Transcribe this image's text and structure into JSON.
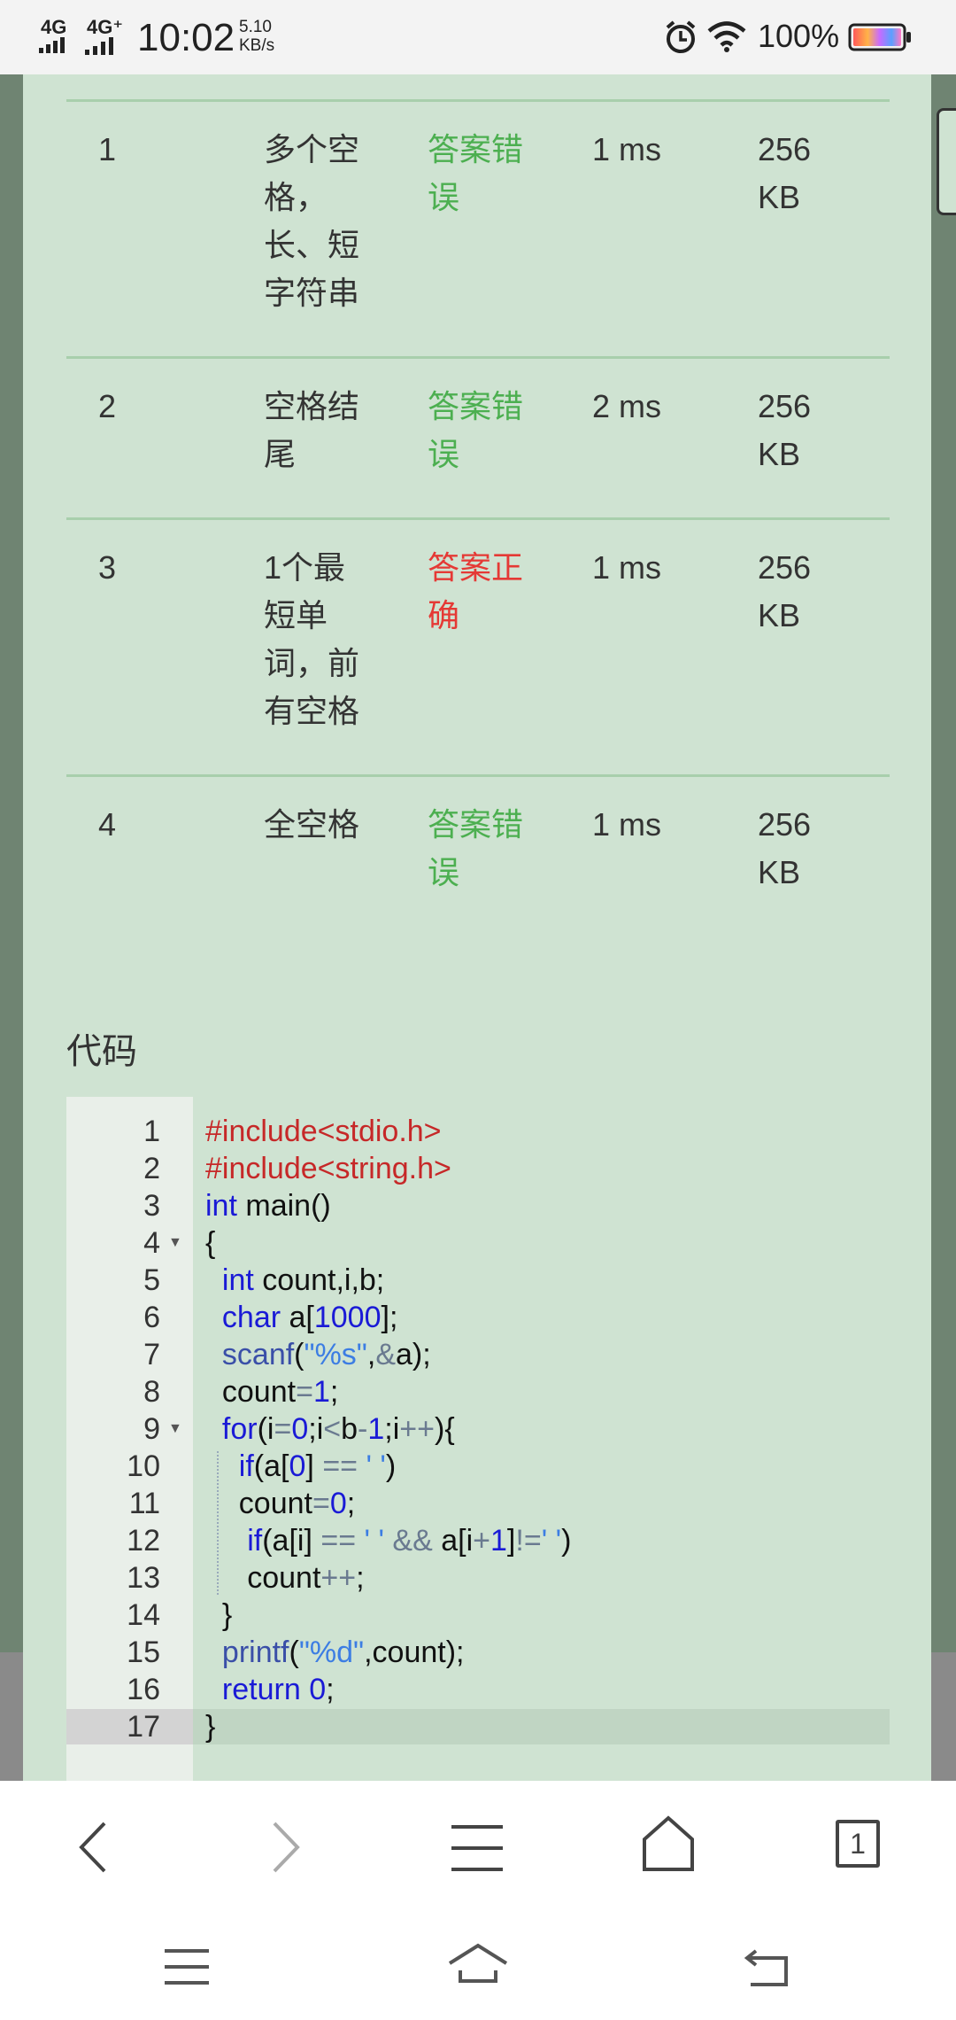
{
  "status_bar": {
    "signal_1": "4G",
    "signal_2": "4G⁺",
    "time": "10:02",
    "speed_value": "5.10",
    "speed_unit": "KB/s",
    "battery_pct": "100%"
  },
  "results": {
    "rows": [
      {
        "num": "1",
        "name_lines": [
          "多个空",
          "格，",
          "长、短",
          "字符串"
        ],
        "result_lines": [
          "答案错",
          "误"
        ],
        "result_type": "wrong",
        "time": "1 ms",
        "mem_lines": [
          "256",
          "KB"
        ]
      },
      {
        "num": "2",
        "name_lines": [
          "空格结",
          "尾"
        ],
        "result_lines": [
          "答案错",
          "误"
        ],
        "result_type": "wrong",
        "time": "2 ms",
        "mem_lines": [
          "256",
          "KB"
        ]
      },
      {
        "num": "3",
        "name_lines": [
          "1个最",
          "短单",
          "词，前",
          "有空格"
        ],
        "result_lines": [
          "答案正",
          "确"
        ],
        "result_type": "right",
        "time": "1 ms",
        "mem_lines": [
          "256",
          "KB"
        ]
      },
      {
        "num": "4",
        "name_lines": [
          "全空格"
        ],
        "result_lines": [
          "答案错",
          "误"
        ],
        "result_type": "wrong",
        "time": "1 ms",
        "mem_lines": [
          "256",
          "KB"
        ]
      }
    ]
  },
  "code": {
    "title": "代码",
    "active_line": 17,
    "fold_lines": [
      4,
      9
    ],
    "lines": [
      [
        [
          "inc",
          "#include"
        ],
        [
          "inc",
          "<stdio.h>"
        ]
      ],
      [
        [
          "inc",
          "#include"
        ],
        [
          "inc",
          "<string.h>"
        ]
      ],
      [
        [
          "kw",
          "int"
        ],
        [
          "",
          " main()"
        ]
      ],
      [
        [
          "",
          "{"
        ]
      ],
      [
        [
          "",
          "  "
        ],
        [
          "kw",
          "int"
        ],
        [
          "",
          " count,i,b;"
        ]
      ],
      [
        [
          "",
          "  "
        ],
        [
          "kw",
          "char"
        ],
        [
          "",
          " a["
        ],
        [
          "num",
          "1000"
        ],
        [
          "",
          "];"
        ]
      ],
      [
        [
          "",
          "  "
        ],
        [
          "fn",
          "scanf"
        ],
        [
          "",
          "("
        ],
        [
          "str",
          "\"%s\""
        ],
        [
          "",
          ","
        ],
        [
          "op",
          "&"
        ],
        [
          "",
          "a);"
        ]
      ],
      [
        [
          "",
          "  count"
        ],
        [
          "op",
          "="
        ],
        [
          "num",
          "1"
        ],
        [
          "",
          ";"
        ]
      ],
      [
        [
          "",
          "  "
        ],
        [
          "kw",
          "for"
        ],
        [
          "",
          "(i"
        ],
        [
          "op",
          "="
        ],
        [
          "num",
          "0"
        ],
        [
          "",
          ";i"
        ],
        [
          "op",
          "<"
        ],
        [
          "",
          "b"
        ],
        [
          "op",
          "-"
        ],
        [
          "num",
          "1"
        ],
        [
          "",
          ";i"
        ],
        [
          "op",
          "++"
        ],
        [
          "",
          "){"
        ]
      ],
      [
        [
          "",
          "    "
        ],
        [
          "kw",
          "if"
        ],
        [
          "",
          "(a["
        ],
        [
          "num",
          "0"
        ],
        [
          "",
          "] "
        ],
        [
          "op",
          "=="
        ],
        [
          "",
          " "
        ],
        [
          "str",
          "' '"
        ],
        [
          "",
          ")"
        ]
      ],
      [
        [
          "",
          "    count"
        ],
        [
          "op",
          "="
        ],
        [
          "num",
          "0"
        ],
        [
          "",
          ";"
        ]
      ],
      [
        [
          "",
          "     "
        ],
        [
          "kw",
          "if"
        ],
        [
          "",
          "(a[i] "
        ],
        [
          "op",
          "=="
        ],
        [
          "",
          " "
        ],
        [
          "str",
          "' '"
        ],
        [
          "",
          " "
        ],
        [
          "op",
          "&&"
        ],
        [
          "",
          " a[i"
        ],
        [
          "op",
          "+"
        ],
        [
          "num",
          "1"
        ],
        [
          "",
          "]"
        ],
        [
          "op",
          "!="
        ],
        [
          "str",
          "' '"
        ],
        [
          "",
          ")"
        ]
      ],
      [
        [
          "",
          "     count"
        ],
        [
          "op",
          "++"
        ],
        [
          "",
          ";"
        ]
      ],
      [
        [
          "",
          "  }"
        ]
      ],
      [
        [
          "",
          "  "
        ],
        [
          "fn",
          "printf"
        ],
        [
          "",
          "("
        ],
        [
          "str",
          "\"%d\""
        ],
        [
          "",
          ",count);"
        ]
      ],
      [
        [
          "",
          "  "
        ],
        [
          "kw",
          "return"
        ],
        [
          "",
          " "
        ],
        [
          "num",
          "0"
        ],
        [
          "",
          ";"
        ]
      ],
      [
        [
          "",
          "}"
        ]
      ]
    ]
  },
  "browser_bar": {
    "tab_count": "1",
    "icons": [
      "back-icon",
      "forward-icon",
      "menu-icon",
      "home-icon",
      "tabs-icon"
    ]
  },
  "system_bar": {
    "icons": [
      "recent-apps-icon",
      "home-icon",
      "back-icon"
    ]
  }
}
